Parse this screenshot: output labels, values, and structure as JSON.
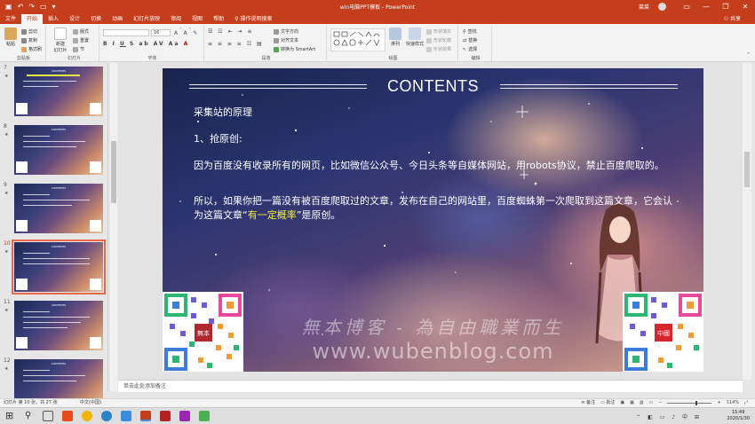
{
  "titlebar": {
    "window_title": "win电脑PPT模板 - PowerPoint",
    "user_name": "菜菜",
    "qat_icons": [
      "save-icon",
      "undo-icon",
      "redo-icon",
      "start-presentation-icon",
      "customize-icon"
    ]
  },
  "menu": {
    "tabs": [
      "文件",
      "开始",
      "插入",
      "设计",
      "切换",
      "动画",
      "幻灯片放映",
      "审阅",
      "视图",
      "帮助",
      "操作说明搜索"
    ],
    "active_tab": "开始",
    "share": "共享"
  },
  "ribbon": {
    "clipboard": {
      "paste": "粘贴",
      "cut": "剪切",
      "copy": "复制",
      "format_painter": "格式刷",
      "label": "剪贴板"
    },
    "slides": {
      "new_slide": "新建\n幻灯片",
      "layout": "版式",
      "reset": "重置",
      "section": "节",
      "label": "幻灯片"
    },
    "font": {
      "font_name": "",
      "font_size": "16",
      "label": "字体"
    },
    "paragraph": {
      "text_direction": "文字方向",
      "align_text": "对齐文本",
      "convert_smartart": "转换为 SmartArt",
      "label": "段落"
    },
    "drawing": {
      "arrange": "排列",
      "quick_styles": "快速样式",
      "shape_fill": "形状填充",
      "shape_outline": "形状轮廓",
      "shape_effects": "形状效果",
      "label": "绘图"
    },
    "editing": {
      "find": "查找",
      "replace": "替换",
      "select": "选择",
      "label": "编辑"
    }
  },
  "slides_panel": {
    "thumbnails": [
      {
        "num": "7",
        "star": "★",
        "selected": false
      },
      {
        "num": "8",
        "star": "★",
        "selected": false
      },
      {
        "num": "9",
        "star": "★",
        "selected": false
      },
      {
        "num": "10",
        "star": "★",
        "selected": true
      },
      {
        "num": "11",
        "star": "★",
        "selected": false
      },
      {
        "num": "12",
        "star": "★",
        "selected": false
      }
    ]
  },
  "slide": {
    "title": "CONTENTS",
    "p1": "采集站的原理",
    "p2": "1、抢原创:",
    "p3": "因为百度没有收录所有的网页，比如微信公众号、今日头条等自媒体网站，用robots协议，禁止百度爬取的。",
    "p4_before": "所以，如果你把一篇没有被百度爬取过的文章，发布在自己的网站里，百度蜘蛛第一次爬取到这篇文章，它会认为这篇文章“",
    "p4_highlight": "有一定概率",
    "p4_after": "”是原创。",
    "qr_left_seal": "無本",
    "qr_right_seal": "中國",
    "watermark_cn": "無本博客 - 為自由職業而生",
    "watermark_url": "www.wubenblog.com"
  },
  "notes": {
    "placeholder": "单击此处添加备注"
  },
  "statusbar": {
    "slide_info": "幻灯片 第 10 张，共 27 张",
    "language": "中文(中国)",
    "notes_btn": "备注",
    "comments_btn": "批注",
    "zoom": "114%"
  },
  "taskbar": {
    "time": "15:49",
    "date": "2020/1/30",
    "ime": "中"
  },
  "colors": {
    "accent": "#c43e1c",
    "highlight": "#f2f03c",
    "selection": "#e8684a"
  }
}
